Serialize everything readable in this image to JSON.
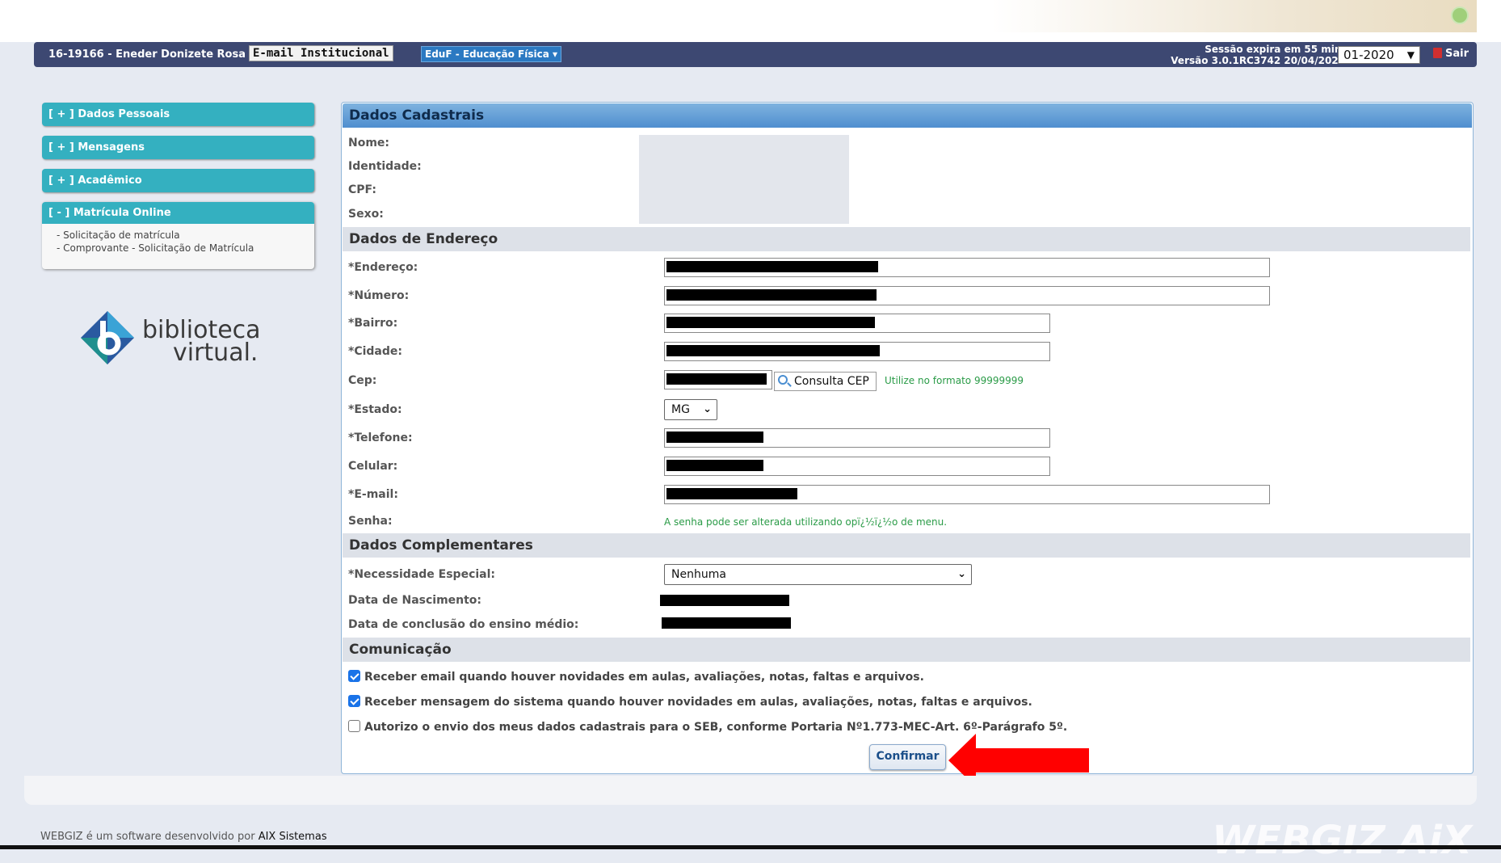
{
  "header": {
    "user": "16-19166 - Eneder Donizete Rosa",
    "email_button": "E-mail Institucional",
    "course": "EduF - Educação Física ▾",
    "session": "Sessão expira em 55 min.",
    "version": "Versão 3.0.1RC3742 20/04/2020",
    "period": "01-2020",
    "logout": "Sair"
  },
  "sidebar": {
    "items": [
      {
        "label": "[ + ] Dados Pessoais"
      },
      {
        "label": "[ + ] Mensagens"
      },
      {
        "label": "[ + ] Acadêmico"
      }
    ],
    "open_item": {
      "label": "[ - ] Matrícula Online",
      "links": [
        "- Solicitação de matrícula",
        "- Comprovante - Solicitação de Matrícula"
      ]
    },
    "logo": {
      "line1": "biblioteca",
      "line2": "virtual."
    }
  },
  "form": {
    "title": "Dados Cadastrais",
    "personal": {
      "nome": "Nome:",
      "identidade": "Identidade:",
      "cpf": "CPF:",
      "sexo": "Sexo:"
    },
    "address_section": "Dados de Endereço",
    "address": {
      "endereco": "*Endereço:",
      "numero": "*Número:",
      "bairro": "*Bairro:",
      "cidade": "*Cidade:",
      "cep": "Cep:",
      "cep_button": "Consulta CEP",
      "cep_hint": "Utilize no formato 99999999",
      "estado": "*Estado:",
      "estado_value": "MG",
      "telefone": "*Telefone:",
      "celular": "Celular:",
      "email": "*E-mail:",
      "senha": "Senha:",
      "senha_hint": "A senha pode ser alterada utilizando opï¿½ï¿½o de menu."
    },
    "complementary_section": "Dados Complementares",
    "complementary": {
      "necessidade": "*Necessidade Especial:",
      "necessidade_value": "Nenhuma",
      "nascimento": "Data de Nascimento:",
      "conclusao": "Data de conclusão do ensino médio:"
    },
    "communication_section": "Comunicação",
    "communication": [
      {
        "label": "Receber email quando houver novidades em aulas, avaliações, notas, faltas e arquivos.",
        "checked": true
      },
      {
        "label": "Receber mensagem do sistema quando houver novidades em aulas, avaliações, notas, faltas e arquivos.",
        "checked": true
      },
      {
        "label": "Autorizo o envio dos meus dados cadastrais para o SEB, conforme Portaria Nº1.773-MEC-Art. 6º-Parágrafo 5º.",
        "checked": false
      }
    ],
    "confirm": "Confirmar"
  },
  "footer": {
    "text": "WEBGIZ é um software desenvolvido por ",
    "link": "AIX Sistemas",
    "logo": "WEBGIZ  AiX"
  },
  "colors": {
    "accent": "#3d4872",
    "menu": "#34b0c0",
    "arrow": "#ff0000",
    "hint": "#2a9b47"
  }
}
